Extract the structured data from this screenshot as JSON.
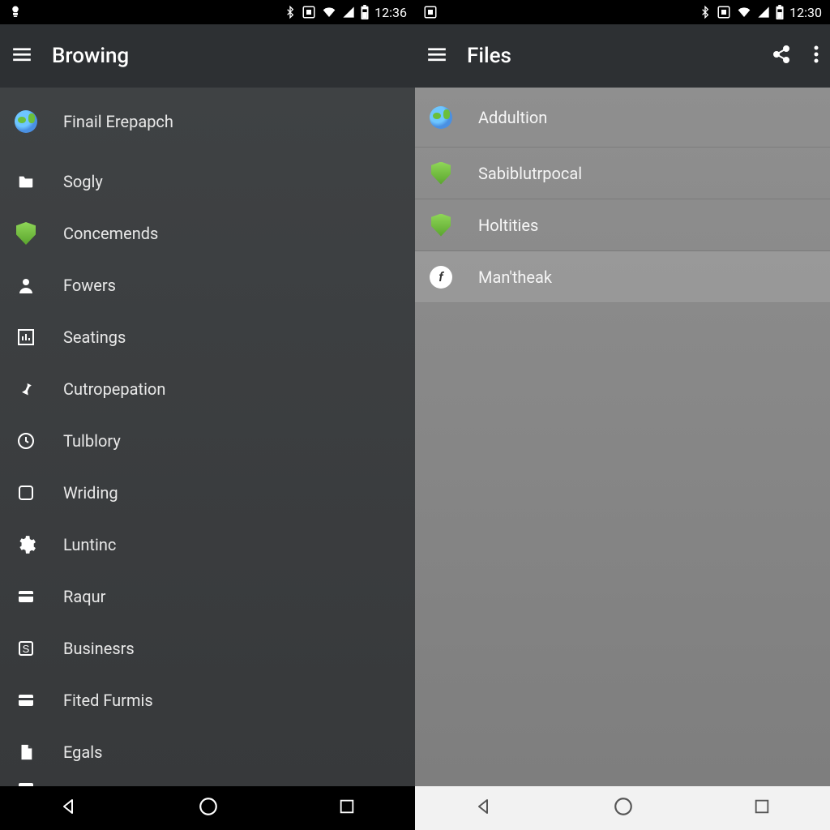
{
  "left": {
    "status_time": "12:36",
    "appbar_title": "Browing",
    "items": [
      {
        "label": "Finail Erepapch",
        "icon": "globe"
      },
      {
        "label": "Sogly",
        "icon": "folder"
      },
      {
        "label": "Concemends",
        "icon": "shield"
      },
      {
        "label": "Fowers",
        "icon": "person"
      },
      {
        "label": "Seatings",
        "icon": "chart"
      },
      {
        "label": "Cutropepation",
        "icon": "pin"
      },
      {
        "label": "Tulblory",
        "icon": "clock"
      },
      {
        "label": "Wriding",
        "icon": "square"
      },
      {
        "label": "Luntinc",
        "icon": "gear"
      },
      {
        "label": "Raqur",
        "icon": "card"
      },
      {
        "label": "Businesrs",
        "icon": "box-s"
      },
      {
        "label": "Fited Furmis",
        "icon": "card"
      },
      {
        "label": "Egals",
        "icon": "doc"
      }
    ]
  },
  "right": {
    "status_time": "12:30",
    "appbar_title": "Files",
    "items": [
      {
        "label": "Addultion",
        "icon": "globe"
      },
      {
        "label": "Sabiblutrpocal",
        "icon": "shield"
      },
      {
        "label": "Holtities",
        "icon": "shield"
      },
      {
        "label": "Man'theak",
        "icon": "circle-f",
        "selected": true
      }
    ]
  }
}
